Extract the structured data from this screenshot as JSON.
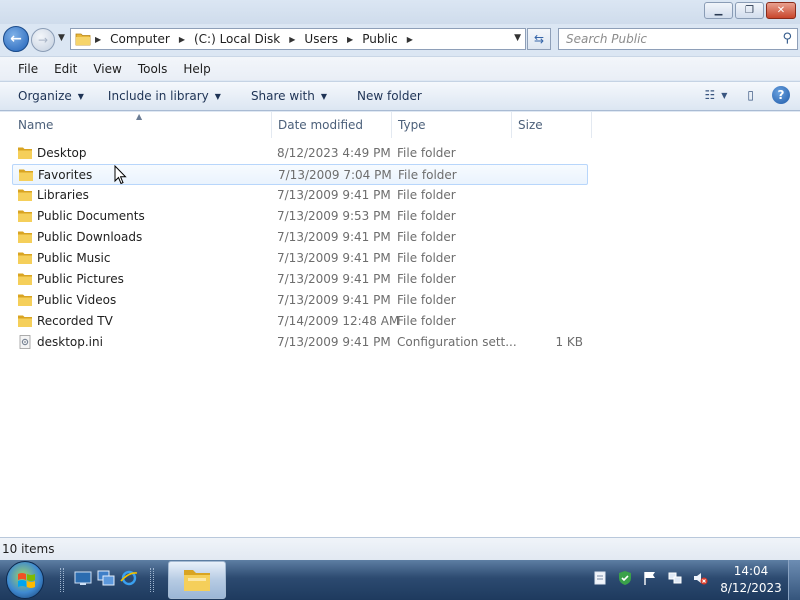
{
  "window": {
    "controls": {
      "minimize": "▁",
      "maximize": "❐",
      "close": "✕"
    }
  },
  "address": {
    "breadcrumbs": [
      "Computer",
      "(C:) Local Disk",
      "Users",
      "Public"
    ],
    "search_placeholder": "Search Public"
  },
  "menu": {
    "items": [
      "File",
      "Edit",
      "View",
      "Tools",
      "Help"
    ]
  },
  "commands": {
    "organize": "Organize",
    "include_in_library": "Include in library",
    "share_with": "Share with",
    "new_folder": "New folder"
  },
  "columns": {
    "name": "Name",
    "date_modified": "Date modified",
    "type": "Type",
    "size": "Size"
  },
  "files": [
    {
      "name": "Desktop",
      "date": "8/12/2023 4:49 PM",
      "type": "File folder",
      "size": "",
      "icon": "folder-icon"
    },
    {
      "name": "Favorites",
      "date": "7/13/2009 7:04 PM",
      "type": "File folder",
      "size": "",
      "icon": "folder-icon"
    },
    {
      "name": "Libraries",
      "date": "7/13/2009 9:41 PM",
      "type": "File folder",
      "size": "",
      "icon": "folder-icon"
    },
    {
      "name": "Public Documents",
      "date": "7/13/2009 9:53 PM",
      "type": "File folder",
      "size": "",
      "icon": "folder-icon"
    },
    {
      "name": "Public Downloads",
      "date": "7/13/2009 9:41 PM",
      "type": "File folder",
      "size": "",
      "icon": "folder-icon"
    },
    {
      "name": "Public Music",
      "date": "7/13/2009 9:41 PM",
      "type": "File folder",
      "size": "",
      "icon": "folder-icon"
    },
    {
      "name": "Public Pictures",
      "date": "7/13/2009 9:41 PM",
      "type": "File folder",
      "size": "",
      "icon": "folder-icon"
    },
    {
      "name": "Public Videos",
      "date": "7/13/2009 9:41 PM",
      "type": "File folder",
      "size": "",
      "icon": "folder-icon"
    },
    {
      "name": "Recorded TV",
      "date": "7/14/2009 12:48 AM",
      "type": "File folder",
      "size": "",
      "icon": "folder-icon"
    },
    {
      "name": "desktop.ini",
      "date": "7/13/2009 9:41 PM",
      "type": "Configuration sett...",
      "size": "1 KB",
      "icon": "settings-file-icon"
    }
  ],
  "status": {
    "item_count": "10 items"
  },
  "taskbar": {
    "time": "14:04",
    "date": "8/12/2023"
  },
  "colors": {
    "hover_row_border": "#b8d6fb",
    "folder_yellow": "#f2c94c",
    "taskbar_blue": "#2c4a70"
  }
}
